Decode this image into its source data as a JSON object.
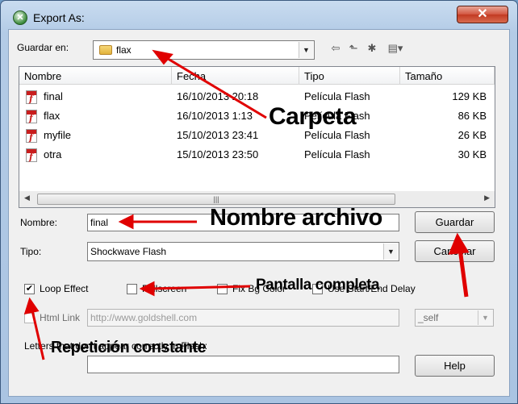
{
  "window": {
    "title": "Export As:",
    "close_glyph": "✕"
  },
  "save_in": {
    "label": "Guardar en:",
    "folder": "flax"
  },
  "toolbar": {
    "back": "⇦",
    "up": "⬑",
    "new_folder": "✱",
    "views": "▤▾"
  },
  "file_list": {
    "columns": [
      "Nombre",
      "Fecha",
      "Tipo",
      "Tamaño"
    ],
    "rows": [
      {
        "name": "final",
        "date": "16/10/2013 20:18",
        "type": "Película Flash",
        "size": "129 KB"
      },
      {
        "name": "flax",
        "date": "16/10/2013 1:13",
        "type": "Película Flash",
        "size": "86 KB"
      },
      {
        "name": "myfile",
        "date": "15/10/2013 23:41",
        "type": "Película Flash",
        "size": "26 KB"
      },
      {
        "name": "otra",
        "date": "15/10/2013 23:50",
        "type": "Película Flash",
        "size": "30 KB"
      }
    ]
  },
  "name_field": {
    "label": "Nombre:",
    "value": "final"
  },
  "type_field": {
    "label": "Tipo:",
    "value": "Shockwave Flash"
  },
  "buttons": {
    "save": "Guardar",
    "cancel": "Cancelar",
    "help": "Help"
  },
  "options": {
    "loop": {
      "label": "Loop Effect",
      "checked": true
    },
    "fullscreen": {
      "label": "Fullscreen",
      "checked": false
    },
    "fix_bg": {
      "label": "Fix Bg Color",
      "checked": false
    },
    "use_start_end_delay": {
      "label": "Use Start/End Delay",
      "checked": false
    }
  },
  "html_link": {
    "label": "Html Link",
    "value": "http://www.goldshell.com",
    "target": "_self"
  },
  "letters": {
    "label": "Letters that don't appear correctly in Flash:",
    "value": ""
  },
  "annotations": {
    "folder": "Carpeta",
    "filename": "Nombre archivo",
    "fullscreen": "Pantalla completa",
    "loop": "Repetición constante"
  },
  "colors": {
    "arrow": "#e00000",
    "title_bg": "#b3cbe6"
  }
}
